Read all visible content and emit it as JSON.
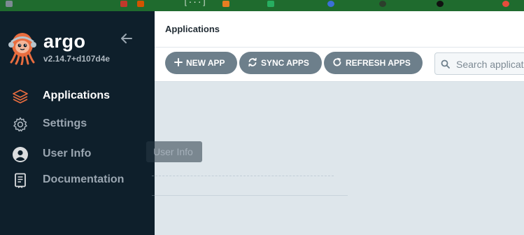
{
  "browser": {
    "tab_bracket": "[···]"
  },
  "sidebar": {
    "brand": "argo",
    "version": "v2.14.7+d107d4e",
    "items": [
      {
        "label": "Applications",
        "icon": "stack-layers-icon",
        "active": true
      },
      {
        "label": "Settings",
        "icon": "gear-icon",
        "active": false
      },
      {
        "label": "User Info",
        "icon": "user-circle-icon",
        "active": false
      },
      {
        "label": "Documentation",
        "icon": "document-icon",
        "active": false
      }
    ]
  },
  "tooltip": {
    "text": "User Info"
  },
  "header": {
    "title": "Applications"
  },
  "toolbar": {
    "new_app": "NEW APP",
    "sync_apps": "SYNC APPS",
    "refresh_apps": "REFRESH APPS"
  },
  "search": {
    "placeholder": "Search applications..."
  },
  "colors": {
    "sidebar_bg": "#0e1f2b",
    "button_bg": "#6d7f8b",
    "content_bg": "#dee6eb",
    "accent_orange": "#e96d3f"
  }
}
